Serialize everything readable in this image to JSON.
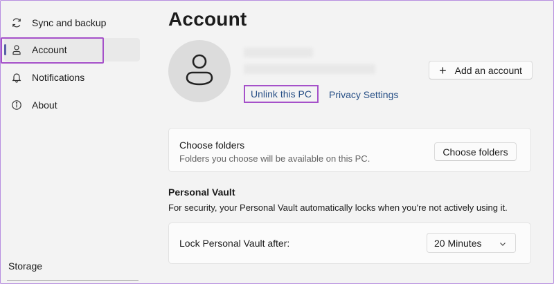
{
  "sidebar": {
    "items": [
      {
        "label": "Sync and backup",
        "icon": "sync-icon"
      },
      {
        "label": "Account",
        "icon": "person-icon",
        "active": true
      },
      {
        "label": "Notifications",
        "icon": "bell-icon"
      },
      {
        "label": "About",
        "icon": "info-icon"
      }
    ],
    "storage_label": "Storage"
  },
  "main": {
    "title": "Account",
    "avatar_icon": "person-icon",
    "unlink_label": "Unlink this PC",
    "privacy_label": "Privacy Settings",
    "add_account_label": "Add an account",
    "folders": {
      "title": "Choose folders",
      "subtitle": "Folders you choose will be available on this PC.",
      "button_label": "Choose folders"
    },
    "vault": {
      "heading": "Personal Vault",
      "description": "For security, your Personal Vault automatically locks when you're not actively using it.",
      "lock_label": "Lock Personal Vault after:",
      "lock_value": "20 Minutes"
    }
  },
  "colors": {
    "accent": "#5b5fa8",
    "link": "#274f86",
    "highlight": "#a550c9"
  }
}
